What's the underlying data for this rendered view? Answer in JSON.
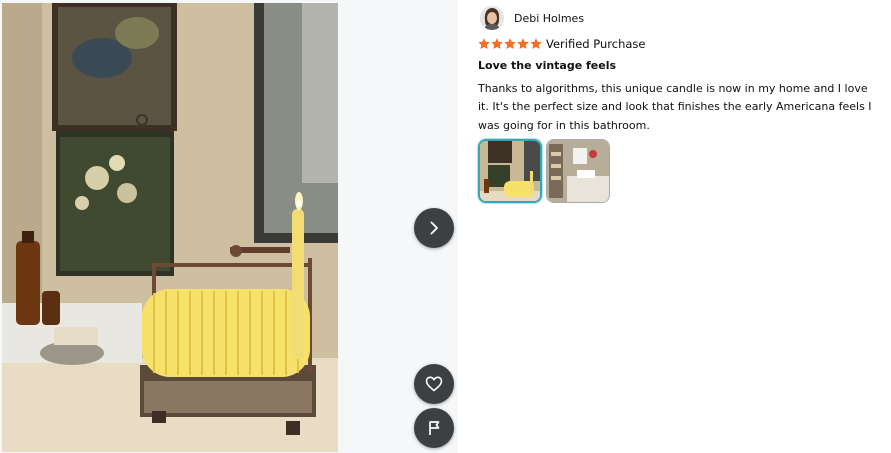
{
  "reviewer": {
    "name": "Debi Holmes",
    "avatar_icon": "reviewer-avatar"
  },
  "rating": {
    "stars": 5,
    "max_stars": 5,
    "star_color": "#ff6f1f",
    "verified_label": "Verified Purchase"
  },
  "review": {
    "title": "Love the vintage feels",
    "body": "Thanks to algorithms, this unique candle is now in my home and I love it. It's the perfect size and look that finishes the early Americana feels I was going for in this bathroom."
  },
  "gallery": {
    "selected_index": 0,
    "thumbnail_count": 2,
    "next_icon": "chevron-right-icon",
    "like_icon": "heart-icon",
    "report_icon": "flag-icon"
  },
  "colors": {
    "button_bg": "#3c4043",
    "selected_border": "#33a6b8",
    "gallery_bg": "#f5f7f8"
  }
}
